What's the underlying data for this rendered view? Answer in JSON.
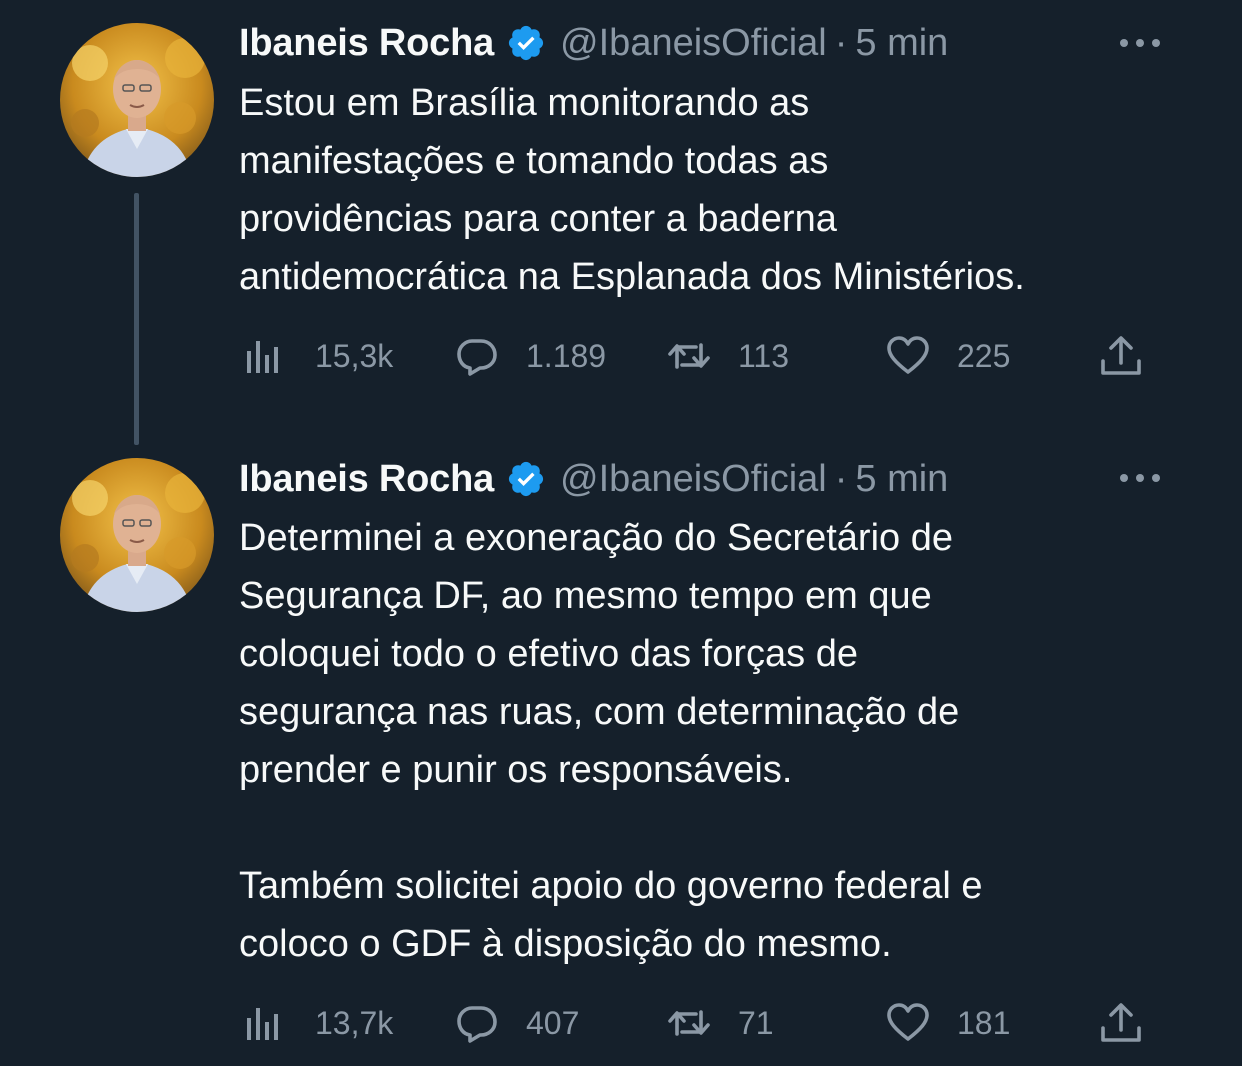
{
  "tweets": [
    {
      "author_name": "Ibaneis Rocha",
      "handle": "@IbaneisOficial",
      "separator": "·",
      "time": "5 min",
      "verified": true,
      "text": "Estou em Brasília monitorando as\nmanifestações e tomando todas as\nprovidências para conter a baderna\nantidemocrática na Esplanada dos Ministérios.",
      "stats": {
        "views": "15,3k",
        "replies": "1.189",
        "retweets": "113",
        "likes": "225"
      }
    },
    {
      "author_name": "Ibaneis Rocha",
      "handle": "@IbaneisOficial",
      "separator": "·",
      "time": "5 min",
      "verified": true,
      "text": "Determinei a exoneração do Secretário de\nSegurança DF, ao mesmo tempo em que\ncoloquei todo o efetivo das forças de\nsegurança nas ruas, com determinação de\nprender e punir os responsáveis.\n\nTambém solicitei apoio do governo federal e\ncoloco o GDF à disposição do mesmo.",
      "stats": {
        "views": "13,7k",
        "replies": "407",
        "retweets": "71",
        "likes": "181"
      }
    }
  ],
  "icons": {
    "views": "analytics-icon",
    "replies": "reply-icon",
    "retweets": "retweet-icon",
    "likes": "heart-icon",
    "share": "share-icon",
    "more": "more-icon",
    "verified": "verified-badge-icon"
  },
  "colors": {
    "background": "#15202b",
    "text_primary": "#f7f9f9",
    "text_secondary": "#8b98a5",
    "verified_blue": "#1d9bf0",
    "thread_line": "#425364"
  }
}
